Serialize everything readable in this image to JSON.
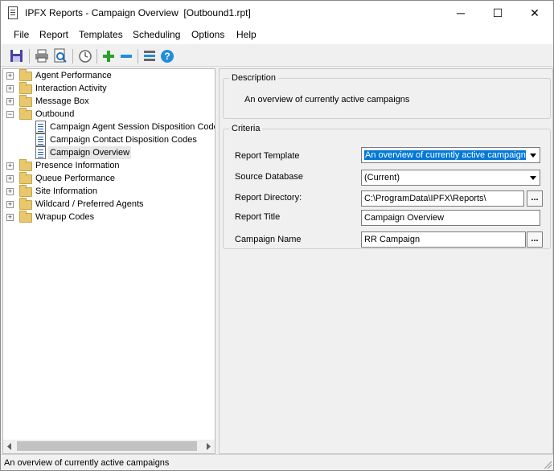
{
  "window": {
    "title": "IPFX Reports - Campaign Overview  [Outbound1.rpt]",
    "minimize": "─",
    "maximize": "☐",
    "close": "✕"
  },
  "menu": {
    "items": [
      {
        "label": "File",
        "accel": "F"
      },
      {
        "label": "Report",
        "accel": "R"
      },
      {
        "label": "Templates",
        "accel": "T"
      },
      {
        "label": "Scheduling",
        "accel": "S"
      },
      {
        "label": "Options",
        "accel": "O"
      },
      {
        "label": "Help",
        "accel": "H"
      }
    ]
  },
  "toolbar": {
    "icons": [
      "save-icon",
      "print-icon",
      "print-preview-icon",
      "clock-icon",
      "add-icon",
      "remove-icon",
      "properties-icon",
      "help-icon"
    ],
    "add_glyph": "+",
    "remove_glyph": "−",
    "help_glyph": "?"
  },
  "tree": {
    "items": [
      {
        "label": "Agent Performance",
        "type": "folder",
        "expanded": false
      },
      {
        "label": "Interaction Activity",
        "type": "folder",
        "expanded": false
      },
      {
        "label": "Message Box",
        "type": "folder",
        "expanded": false
      },
      {
        "label": "Outbound",
        "type": "folder",
        "expanded": true
      },
      {
        "label": "Campaign Agent Session Disposition Codes",
        "type": "report"
      },
      {
        "label": "Campaign Contact Disposition Codes",
        "type": "report"
      },
      {
        "label": "Campaign Overview",
        "type": "report",
        "selected": true
      },
      {
        "label": "Presence Information",
        "type": "folder",
        "expanded": false
      },
      {
        "label": "Queue Performance",
        "type": "folder",
        "expanded": false
      },
      {
        "label": "Site Information",
        "type": "folder",
        "expanded": false
      },
      {
        "label": "Wildcard / Preferred Agents",
        "type": "folder",
        "expanded": false
      },
      {
        "label": "Wrapup Codes",
        "type": "folder",
        "expanded": false
      }
    ],
    "collapsed_glyph": "+",
    "expanded_glyph": "−"
  },
  "description": {
    "legend": "Description",
    "text": "An overview of currently active campaigns"
  },
  "criteria": {
    "legend": "Criteria",
    "report_template_label": "Report Template",
    "report_template_accel": "T",
    "report_template_value": "An overview of currently active campaigns",
    "source_database_label": "Source Database",
    "source_database_accel": "b",
    "source_database_value": "(Current)",
    "report_directory_label": "Report Directory:",
    "report_directory_accel": "D",
    "report_directory_value": "C:\\ProgramData\\IPFX\\Reports\\",
    "report_title_label": "Report Title",
    "report_title_accel": "e",
    "report_title_value": "Campaign Overview",
    "campaign_name_label": "Campaign Name",
    "campaign_name_value": "RR Campaign",
    "browse_label": "..."
  },
  "status_bar": {
    "text": "An overview of currently active campaigns"
  },
  "colors": {
    "selection": "#0078d7",
    "folder": "#e8c86c",
    "add": "#2aa12a",
    "remove": "#1f8fdc",
    "help": "#1f8fdc",
    "save": "#4b3fa8"
  }
}
